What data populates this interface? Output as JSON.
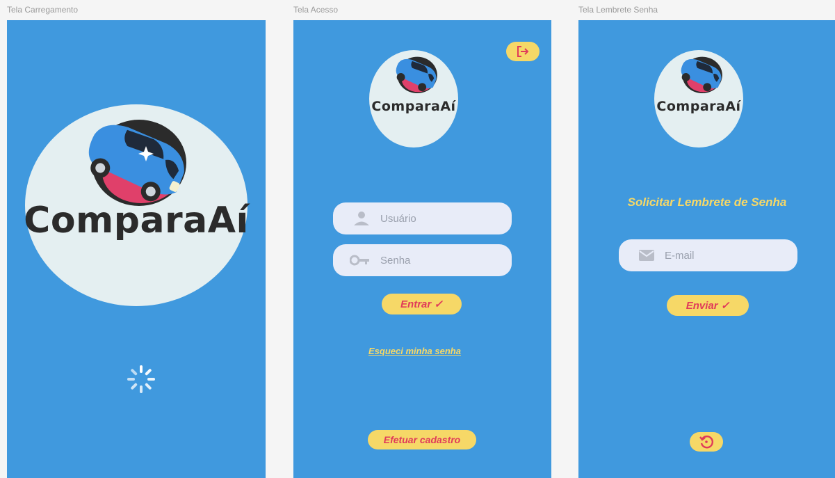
{
  "screens": {
    "loading": {
      "label": "Tela Carregamento",
      "logo_text": "ComparaAí",
      "spinner_icon": "loading-spinner-icon"
    },
    "login": {
      "label": "Tela Acesso",
      "logo_text": "ComparaAí",
      "exit_icon": "exit-icon",
      "username_placeholder": "Usuário",
      "password_placeholder": "Senha",
      "login_button": "Entrar ✓",
      "forgot_password_link": "Esqueci minha senha",
      "register_button": "Efetuar cadastro"
    },
    "reminder": {
      "label": "Tela Lembrete Senha",
      "logo_text": "ComparaAí",
      "heading": "Solicitar Lembrete de Senha",
      "email_placeholder": "E-mail",
      "send_button": "Enviar ✓",
      "back_icon": "undo-icon"
    }
  },
  "colors": {
    "screen_bg": "#4099de",
    "logo_bg": "#e4eff1",
    "accent_yellow": "#f6d867",
    "accent_red": "#e03a5a",
    "field_bg": "#e8ecf8"
  }
}
